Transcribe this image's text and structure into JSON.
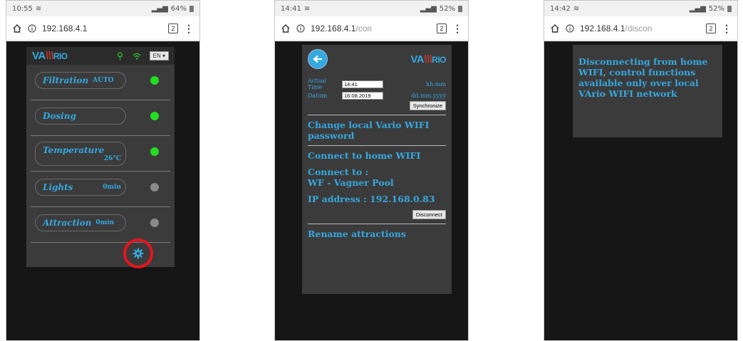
{
  "phone1": {
    "status": {
      "time": "10:55",
      "battery": "64%"
    },
    "url": {
      "host": "192.168.4.1",
      "path": "",
      "tabs": "2"
    },
    "logo": {
      "va": "VA",
      "rio": "RIO"
    },
    "lang": "EN ▾",
    "rows": [
      {
        "label": "Filtration",
        "sub": "AUTO",
        "led": "green"
      },
      {
        "label": "Dosing",
        "sub": "",
        "led": "green"
      },
      {
        "label": "Temperature",
        "sub": "26°C",
        "led": "green"
      },
      {
        "label": "Lights",
        "sub": "0min",
        "led": "gray"
      },
      {
        "label": "Attraction",
        "sub": "0min",
        "led": "gray"
      }
    ]
  },
  "phone2": {
    "status": {
      "time": "14:41",
      "battery": "52%"
    },
    "url": {
      "host": "192.168.4.1",
      "path": "/con",
      "tabs": "2"
    },
    "logo": {
      "va": "VA",
      "rio": "RIO"
    },
    "time_label": "Actual Time",
    "time_value": "14:41",
    "time_format": "hh:mm",
    "date_label": "Datum",
    "date_value": "16.08.2019",
    "date_format": "dd.mm.yyyy",
    "sync_label": "Synchronize",
    "change_pw": "Change local Vario WIFI password",
    "connect_home": "Connect to home WIFI",
    "connect_to": "Connect to :",
    "network": "WF - Vagner Pool",
    "ip": "IP address : 192.168.0.83",
    "disconnect_label": "Disconnect",
    "rename": "Rename attractions"
  },
  "phone3": {
    "status": {
      "time": "14:42",
      "battery": "52%"
    },
    "url": {
      "host": "192.168.4.1",
      "path": "/discon",
      "tabs": "2"
    },
    "message": "Disconnecting from home WIFI, control functions available only over local VArio WIFI network"
  }
}
